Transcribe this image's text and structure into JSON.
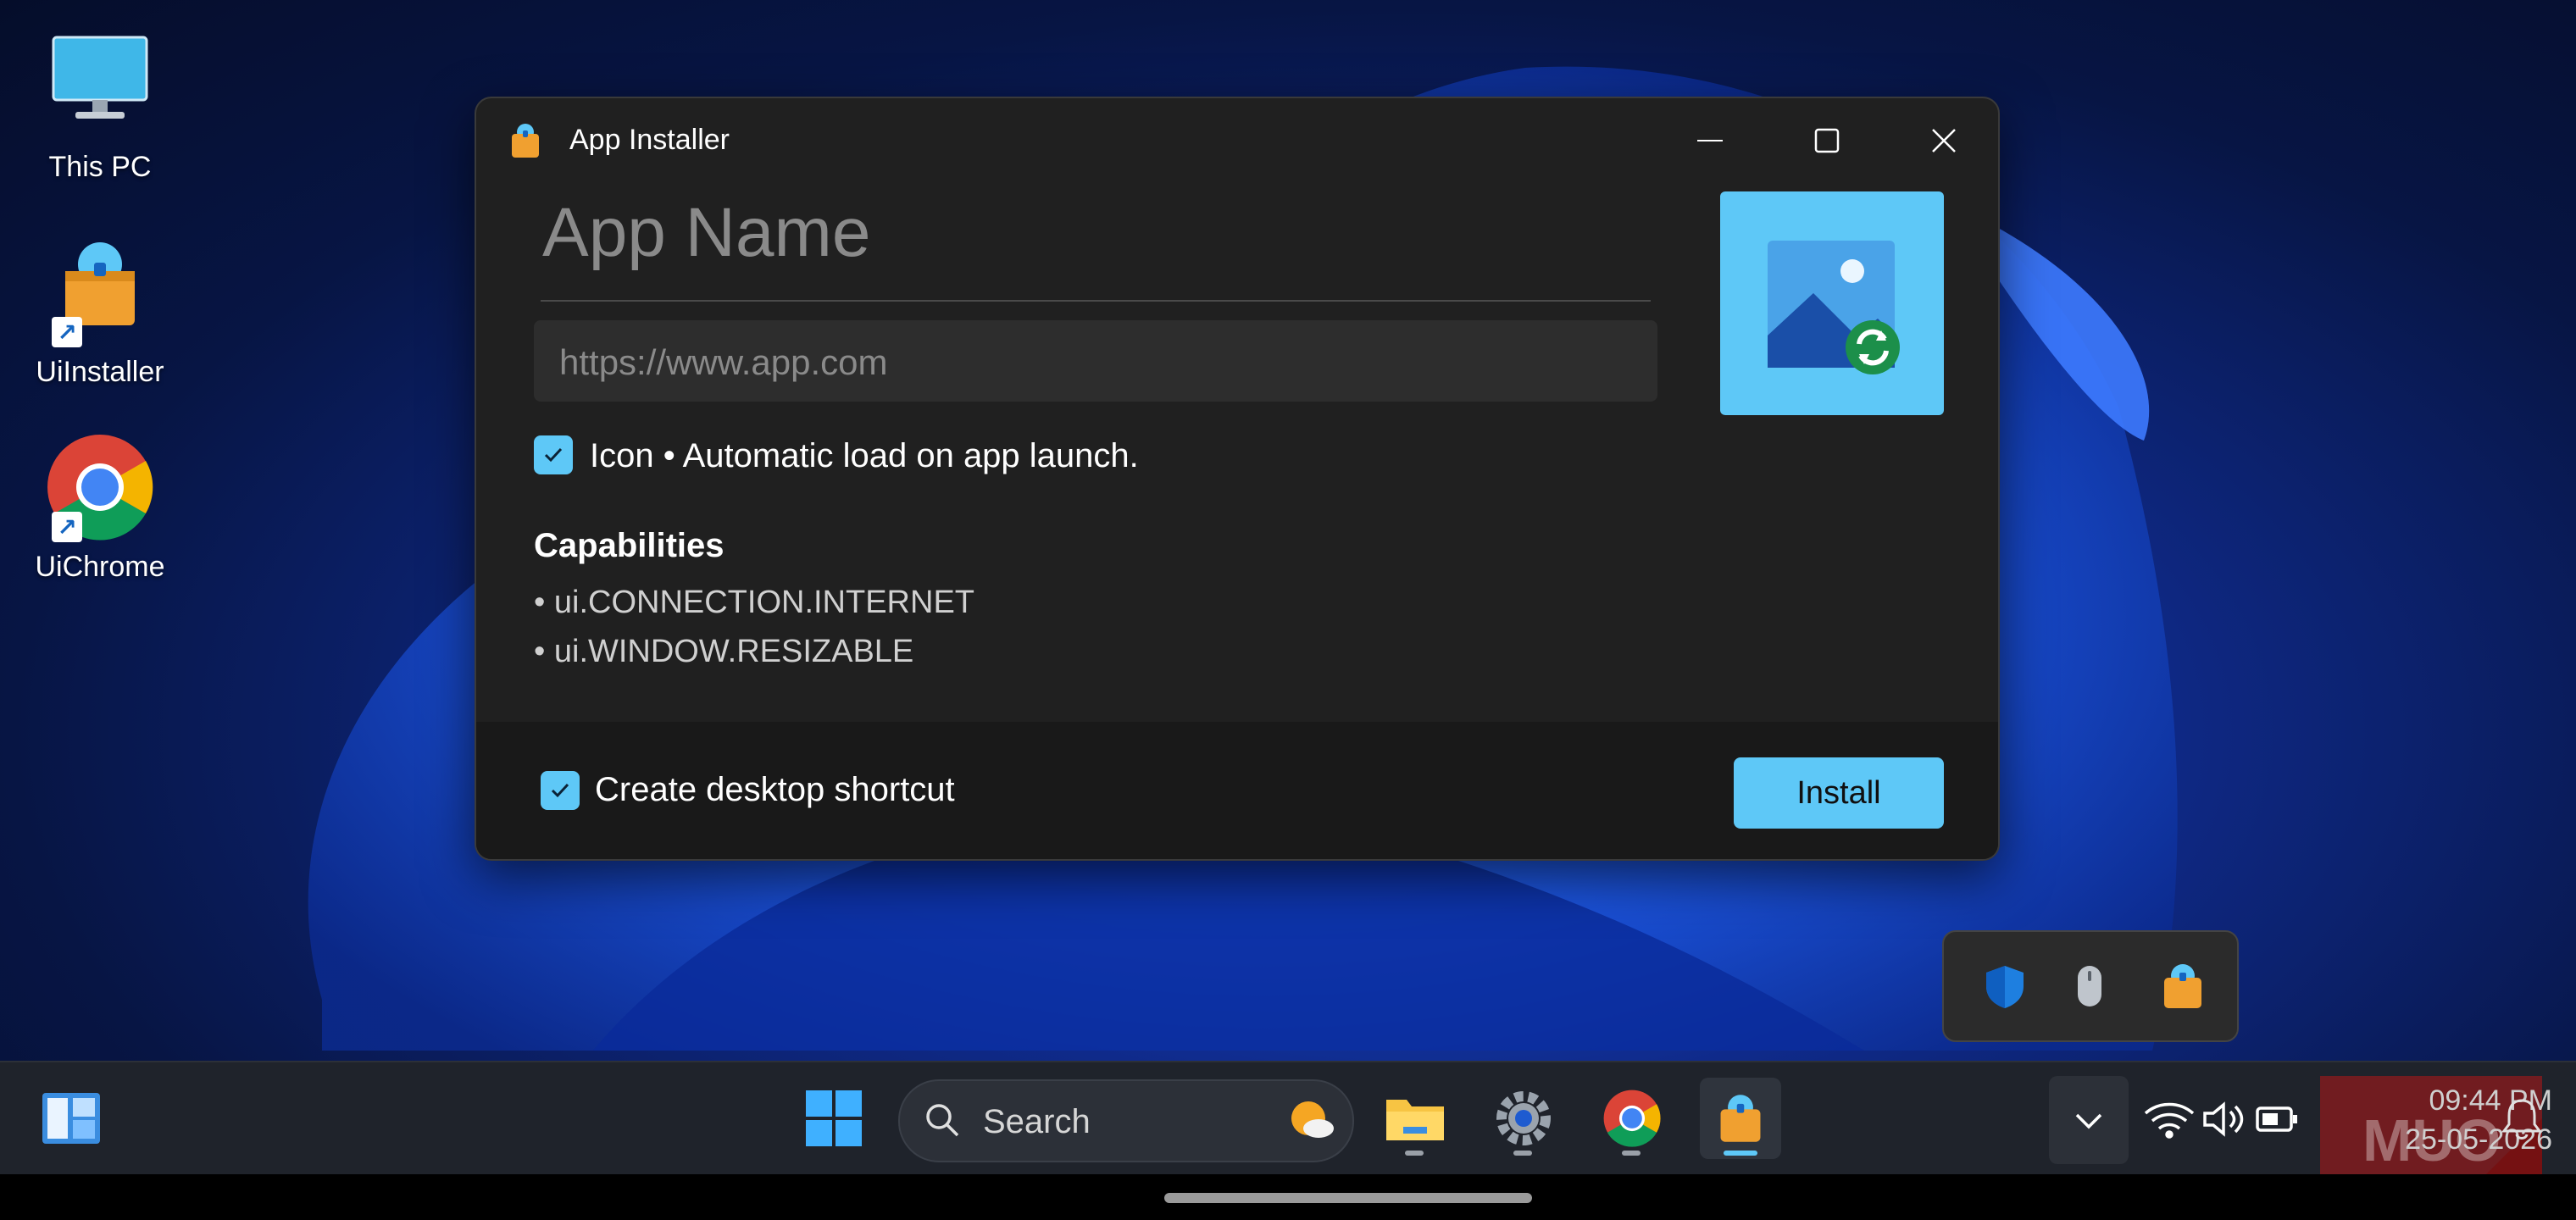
{
  "desktop": {
    "icons": [
      {
        "label": "This PC",
        "icon": "monitor-icon"
      },
      {
        "label": "UiInstaller",
        "icon": "installer-bag-icon"
      },
      {
        "label": "UiChrome",
        "icon": "chrome-icon"
      }
    ]
  },
  "window": {
    "title": "App Installer",
    "app_name_placeholder": "App Name",
    "url_placeholder": "https://www.app.com",
    "icon_option": {
      "label": "Icon • Automatic load on app launch.",
      "checked": true
    },
    "capabilities_title": "Capabilities",
    "capabilities": [
      "• ui.CONNECTION.INTERNET",
      "• ui.WINDOW.RESIZABLE"
    ],
    "shortcut_option": {
      "label": "Create desktop shortcut",
      "checked": true
    },
    "install_label": "Install",
    "colors": {
      "accent": "#5ec8f7",
      "background": "#202020",
      "footer": "#191919"
    }
  },
  "tray_flyout": {
    "icons": [
      "defender-shield-icon",
      "mouse-icon",
      "installer-bag-icon"
    ]
  },
  "taskbar": {
    "search_placeholder": "Search",
    "pinned": [
      "file-explorer-icon",
      "settings-icon",
      "chrome-icon",
      "installer-bag-icon"
    ],
    "clock": {
      "time": "09:44 PM",
      "date": "25-05-2026"
    }
  }
}
